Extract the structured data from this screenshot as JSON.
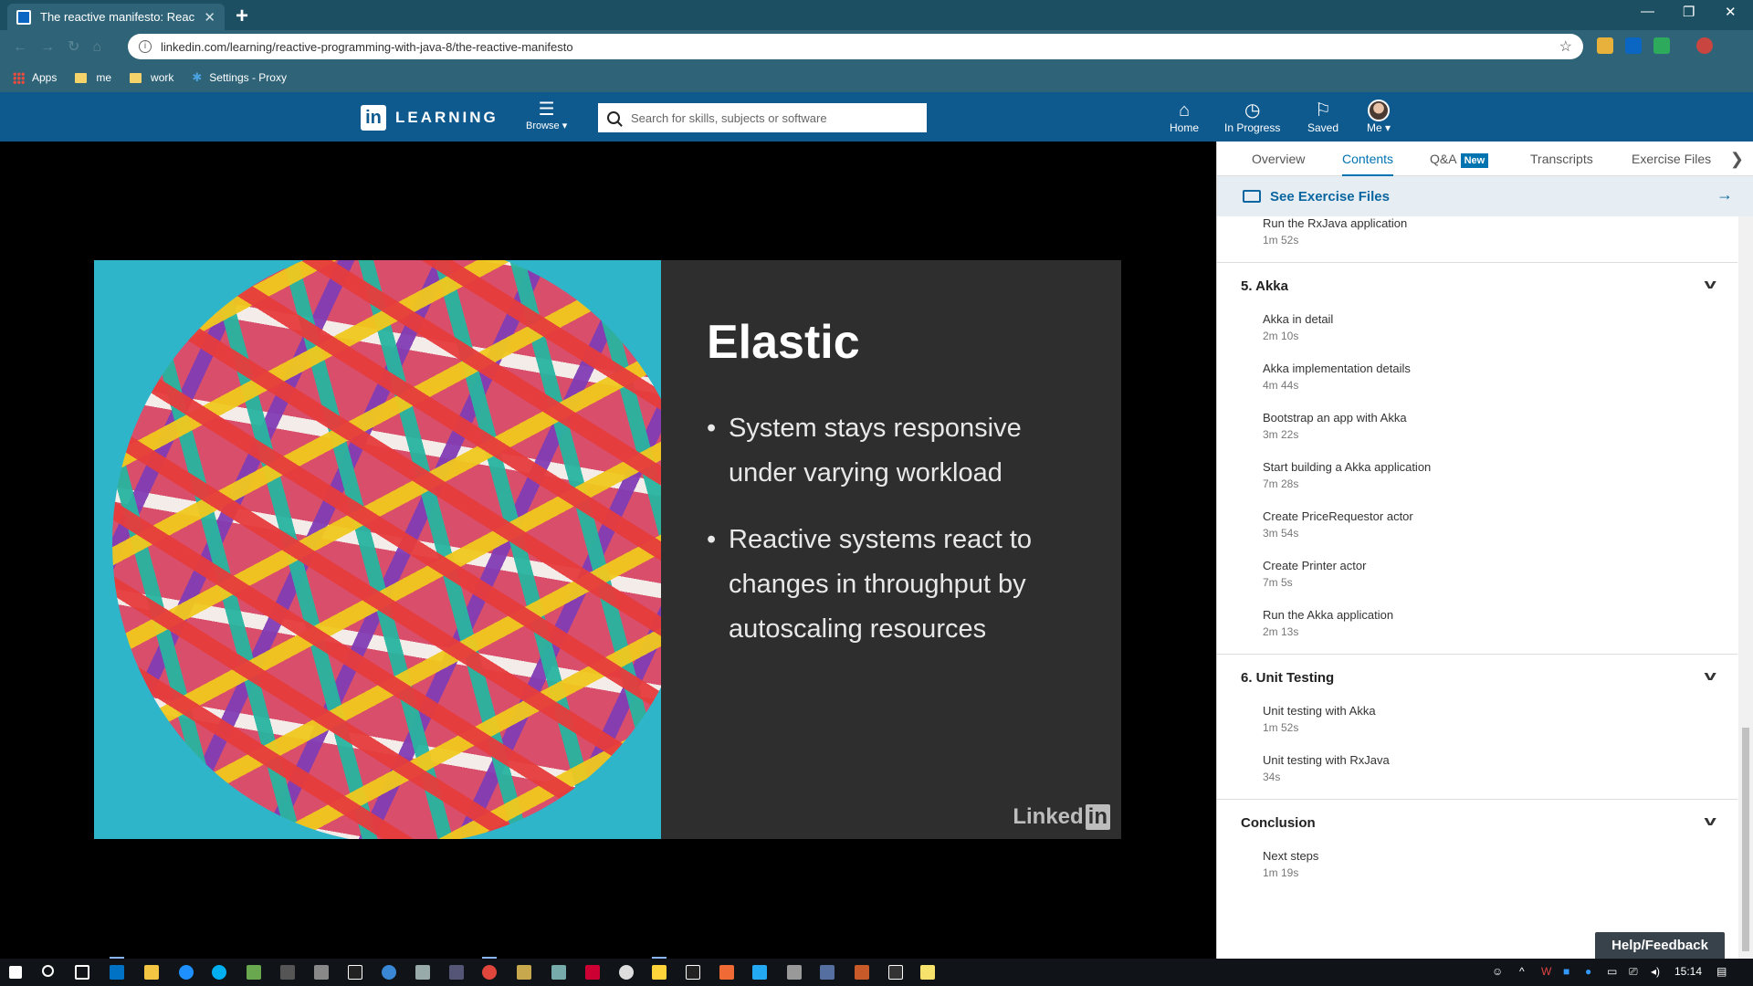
{
  "browser": {
    "tab_title": "The reactive manifesto: Reac",
    "url": "linkedin.com/learning/reactive-programming-with-java-8/the-reactive-manifesto",
    "bookmarks": [
      "Apps",
      "me",
      "work",
      "Settings - Proxy"
    ]
  },
  "header": {
    "logo_in": "in",
    "logo_word": "LEARNING",
    "browse_label": "Browse ▾",
    "search_placeholder": "Search for skills, subjects or software",
    "nav": {
      "home": "Home",
      "in_progress": "In Progress",
      "saved": "Saved",
      "me": "Me ▾"
    }
  },
  "slide": {
    "title": "Elastic",
    "bullets": [
      "System stays responsive under varying workload",
      "Reactive systems react to changes in throughput by autoscaling resources"
    ],
    "watermark": "Linked",
    "watermark_box": "in"
  },
  "panel": {
    "tabs": {
      "overview": "Overview",
      "contents": "Contents",
      "qa": "Q&A",
      "qa_badge": "New",
      "transcripts": "Transcripts",
      "exercise_files": "Exercise Files"
    },
    "see_exercise_files": "See Exercise Files",
    "toc": {
      "prev_item": {
        "title": "Run the RxJava application",
        "duration": "1m 52s"
      },
      "chapters": [
        {
          "title": "5. Akka",
          "items": [
            {
              "title": "Akka in detail",
              "duration": "2m 10s"
            },
            {
              "title": "Akka implementation details",
              "duration": "4m 44s"
            },
            {
              "title": "Bootstrap an app with Akka",
              "duration": "3m 22s"
            },
            {
              "title": "Start building a Akka application",
              "duration": "7m 28s"
            },
            {
              "title": "Create PriceRequestor actor",
              "duration": "3m 54s"
            },
            {
              "title": "Create Printer actor",
              "duration": "7m 5s"
            },
            {
              "title": "Run the Akka application",
              "duration": "2m 13s"
            }
          ]
        },
        {
          "title": "6. Unit Testing",
          "items": [
            {
              "title": "Unit testing with Akka",
              "duration": "1m 52s"
            },
            {
              "title": "Unit testing with RxJava",
              "duration": "34s"
            }
          ]
        },
        {
          "title": "Conclusion",
          "items": [
            {
              "title": "Next steps",
              "duration": "1m 19s"
            }
          ]
        }
      ]
    },
    "help_feedback": "Help/Feedback"
  },
  "taskbar": {
    "time": "15:14"
  }
}
